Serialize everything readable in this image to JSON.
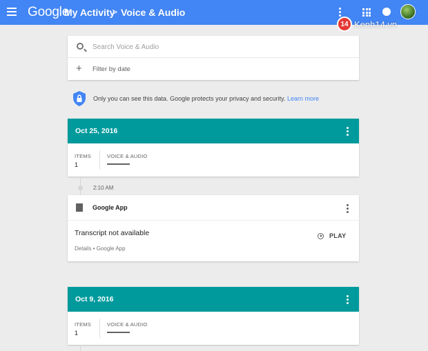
{
  "appbar": {
    "logo": "Google",
    "breadcrumb": [
      "My Activity",
      "Voice & Audio"
    ],
    "separator": ">",
    "color": "#4285f4"
  },
  "watermark": {
    "badge": "14",
    "text": "Kenh14.vn"
  },
  "search": {
    "placeholder": "Search Voice & Audio",
    "value": ""
  },
  "filter": {
    "label": "Filter by date"
  },
  "privacy": {
    "text": "Only you can see this data. Google protects your privacy and security.",
    "link": "Learn more"
  },
  "accent_color": "#009a9c",
  "days": [
    {
      "date": "Oct 25, 2016",
      "summary": {
        "items_label": "ITEMS",
        "items_count": "1",
        "category_label": "VOICE & AUDIO"
      },
      "entries": [
        {
          "time": "2:10 AM",
          "app": "Google App",
          "icon": "document-icon",
          "transcript": "Transcript not available",
          "details": "Details • Google App",
          "play_label": "PLAY"
        }
      ]
    },
    {
      "date": "Oct 9, 2016",
      "summary": {
        "items_label": "ITEMS",
        "items_count": "1",
        "category_label": "VOICE & AUDIO"
      }
    }
  ]
}
